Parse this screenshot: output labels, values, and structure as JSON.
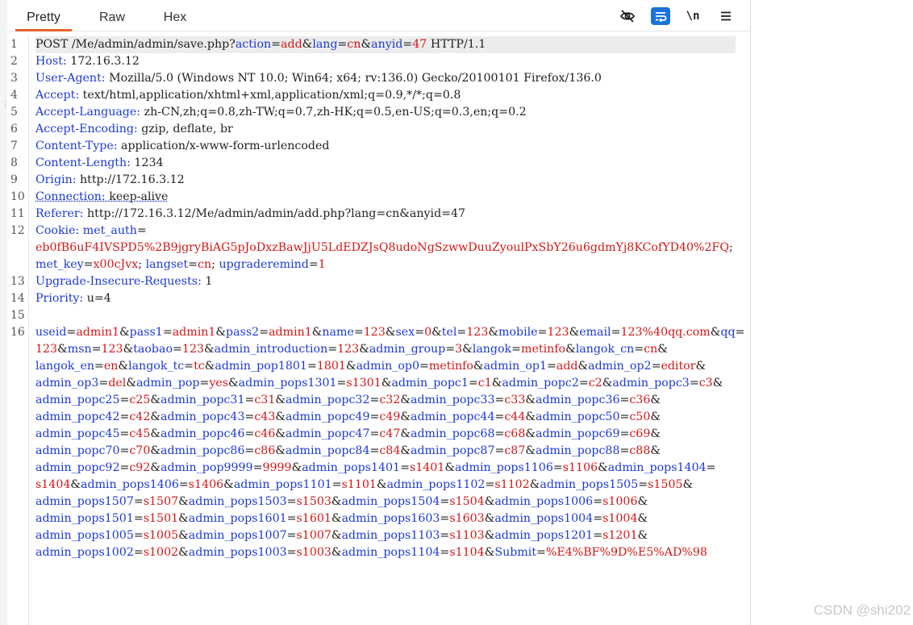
{
  "tabs": [
    "Pretty",
    "Raw",
    "Hex"
  ],
  "active_tab": "Pretty",
  "toolbar": {
    "hide_icon": "eye-slash-icon",
    "wrap_icon": "wrap-lines-icon",
    "newline_label": "\\n",
    "menu_icon": "hamburger-menu-icon"
  },
  "colors": {
    "tab_accent": "#e8622a",
    "key": "#1d3ad0",
    "value": "#d01818",
    "wrap_button": "#1a73d9"
  },
  "line_numbers": [
    "1",
    "2",
    "3",
    "4",
    "5",
    "6",
    "7",
    "8",
    "9",
    "10",
    "11",
    "12",
    "13",
    "14",
    "15",
    "16"
  ],
  "request": {
    "line1": {
      "method_path": "POST /Me/admin/admin/save.php?",
      "params": [
        [
          "action",
          "add"
        ],
        [
          "lang",
          "cn"
        ],
        [
          "anyid",
          "47"
        ]
      ],
      "protocol": " HTTP/1.1"
    },
    "headers": [
      [
        "Host",
        "172.16.3.12"
      ],
      [
        "User-Agent",
        "Mozilla/5.0 (Windows NT 10.0; Win64; x64; rv:136.0) Gecko/20100101 Firefox/136.0"
      ],
      [
        "Accept",
        "text/html,application/xhtml+xml,application/xml;q=0.9,*/*;q=0.8"
      ],
      [
        "Accept-Language",
        "zh-CN,zh;q=0.8,zh-TW;q=0.7,zh-HK;q=0.5,en-US;q=0.3,en;q=0.2"
      ],
      [
        "Accept-Encoding",
        "gzip, deflate, br"
      ],
      [
        "Content-Type",
        "application/x-www-form-urlencoded"
      ],
      [
        "Content-Length",
        "1234"
      ],
      [
        "Origin",
        "http://172.16.3.12"
      ],
      [
        "Connection",
        "keep-alive"
      ],
      [
        "Referer",
        "http://172.16.3.12/Me/admin/admin/add.php?lang=cn&anyid=47"
      ]
    ],
    "cookie": {
      "label": "Cookie",
      "items": [
        [
          "met_auth",
          "eb0fB6uF4IVSPD5%2B9jgryBiAG5pJoDxzBawJjU5LdEDZJsQ8udoNgSzwwDuuZyoulPxSbY26u6gdmYj8KCofYD40%2FQ"
        ],
        [
          "met_key",
          "x00cJvx"
        ],
        [
          "langset",
          "cn"
        ],
        [
          "upgraderemind",
          "1"
        ]
      ]
    },
    "headers_after": [
      [
        "Upgrade-Insecure-Requests",
        "1"
      ],
      [
        "Priority",
        "u=4"
      ]
    ],
    "body": [
      [
        "useid",
        "admin1"
      ],
      [
        "pass1",
        "admin1"
      ],
      [
        "pass2",
        "admin1"
      ],
      [
        "name",
        "123"
      ],
      [
        "sex",
        "0"
      ],
      [
        "tel",
        "123"
      ],
      [
        "mobile",
        "123"
      ],
      [
        "email",
        "123%40qq.com"
      ],
      [
        "qq",
        "123"
      ],
      [
        "msn",
        "123"
      ],
      [
        "taobao",
        "123"
      ],
      [
        "admin_introduction",
        "123"
      ],
      [
        "admin_group",
        "3"
      ],
      [
        "langok",
        "metinfo"
      ],
      [
        "langok_cn",
        "cn"
      ],
      [
        "langok_en",
        "en"
      ],
      [
        "langok_tc",
        "tc"
      ],
      [
        "admin_pop1801",
        "1801"
      ],
      [
        "admin_op0",
        "metinfo"
      ],
      [
        "admin_op1",
        "add"
      ],
      [
        "admin_op2",
        "editor"
      ],
      [
        "admin_op3",
        "del"
      ],
      [
        "admin_pop",
        "yes"
      ],
      [
        "admin_pops1301",
        "s1301"
      ],
      [
        "admin_popc1",
        "c1"
      ],
      [
        "admin_popc2",
        "c2"
      ],
      [
        "admin_popc3",
        "c3"
      ],
      [
        "admin_popc25",
        "c25"
      ],
      [
        "admin_popc31",
        "c31"
      ],
      [
        "admin_popc32",
        "c32"
      ],
      [
        "admin_popc33",
        "c33"
      ],
      [
        "admin_popc36",
        "c36"
      ],
      [
        "admin_popc42",
        "c42"
      ],
      [
        "admin_popc43",
        "c43"
      ],
      [
        "admin_popc49",
        "c49"
      ],
      [
        "admin_popc44",
        "c44"
      ],
      [
        "admin_popc50",
        "c50"
      ],
      [
        "admin_popc45",
        "c45"
      ],
      [
        "admin_popc46",
        "c46"
      ],
      [
        "admin_popc47",
        "c47"
      ],
      [
        "admin_popc68",
        "c68"
      ],
      [
        "admin_popc69",
        "c69"
      ],
      [
        "admin_popc70",
        "c70"
      ],
      [
        "admin_popc86",
        "c86"
      ],
      [
        "admin_popc84",
        "c84"
      ],
      [
        "admin_popc87",
        "c87"
      ],
      [
        "admin_popc88",
        "c88"
      ],
      [
        "admin_popc92",
        "c92"
      ],
      [
        "admin_pop9999",
        "9999"
      ],
      [
        "admin_pops1401",
        "s1401"
      ],
      [
        "admin_pops1106",
        "s1106"
      ],
      [
        "admin_pops1404",
        "s1404"
      ],
      [
        "admin_pops1406",
        "s1406"
      ],
      [
        "admin_pops1101",
        "s1101"
      ],
      [
        "admin_pops1102",
        "s1102"
      ],
      [
        "admin_pops1505",
        "s1505"
      ],
      [
        "admin_pops1507",
        "s1507"
      ],
      [
        "admin_pops1503",
        "s1503"
      ],
      [
        "admin_pops1504",
        "s1504"
      ],
      [
        "admin_pops1006",
        "s1006"
      ],
      [
        "admin_pops1501",
        "s1501"
      ],
      [
        "admin_pops1601",
        "s1601"
      ],
      [
        "admin_pops1603",
        "s1603"
      ],
      [
        "admin_pops1004",
        "s1004"
      ],
      [
        "admin_pops1005",
        "s1005"
      ],
      [
        "admin_pops1007",
        "s1007"
      ],
      [
        "admin_pops1103",
        "s1103"
      ],
      [
        "admin_pops1201",
        "s1201"
      ],
      [
        "admin_pops1002",
        "s1002"
      ],
      [
        "admin_pops1003",
        "s1003"
      ],
      [
        "admin_pops1104",
        "s1104"
      ],
      [
        "Submit",
        "%E4%BF%9D%E5%AD%98"
      ]
    ]
  },
  "watermark": "CSDN @shi202"
}
